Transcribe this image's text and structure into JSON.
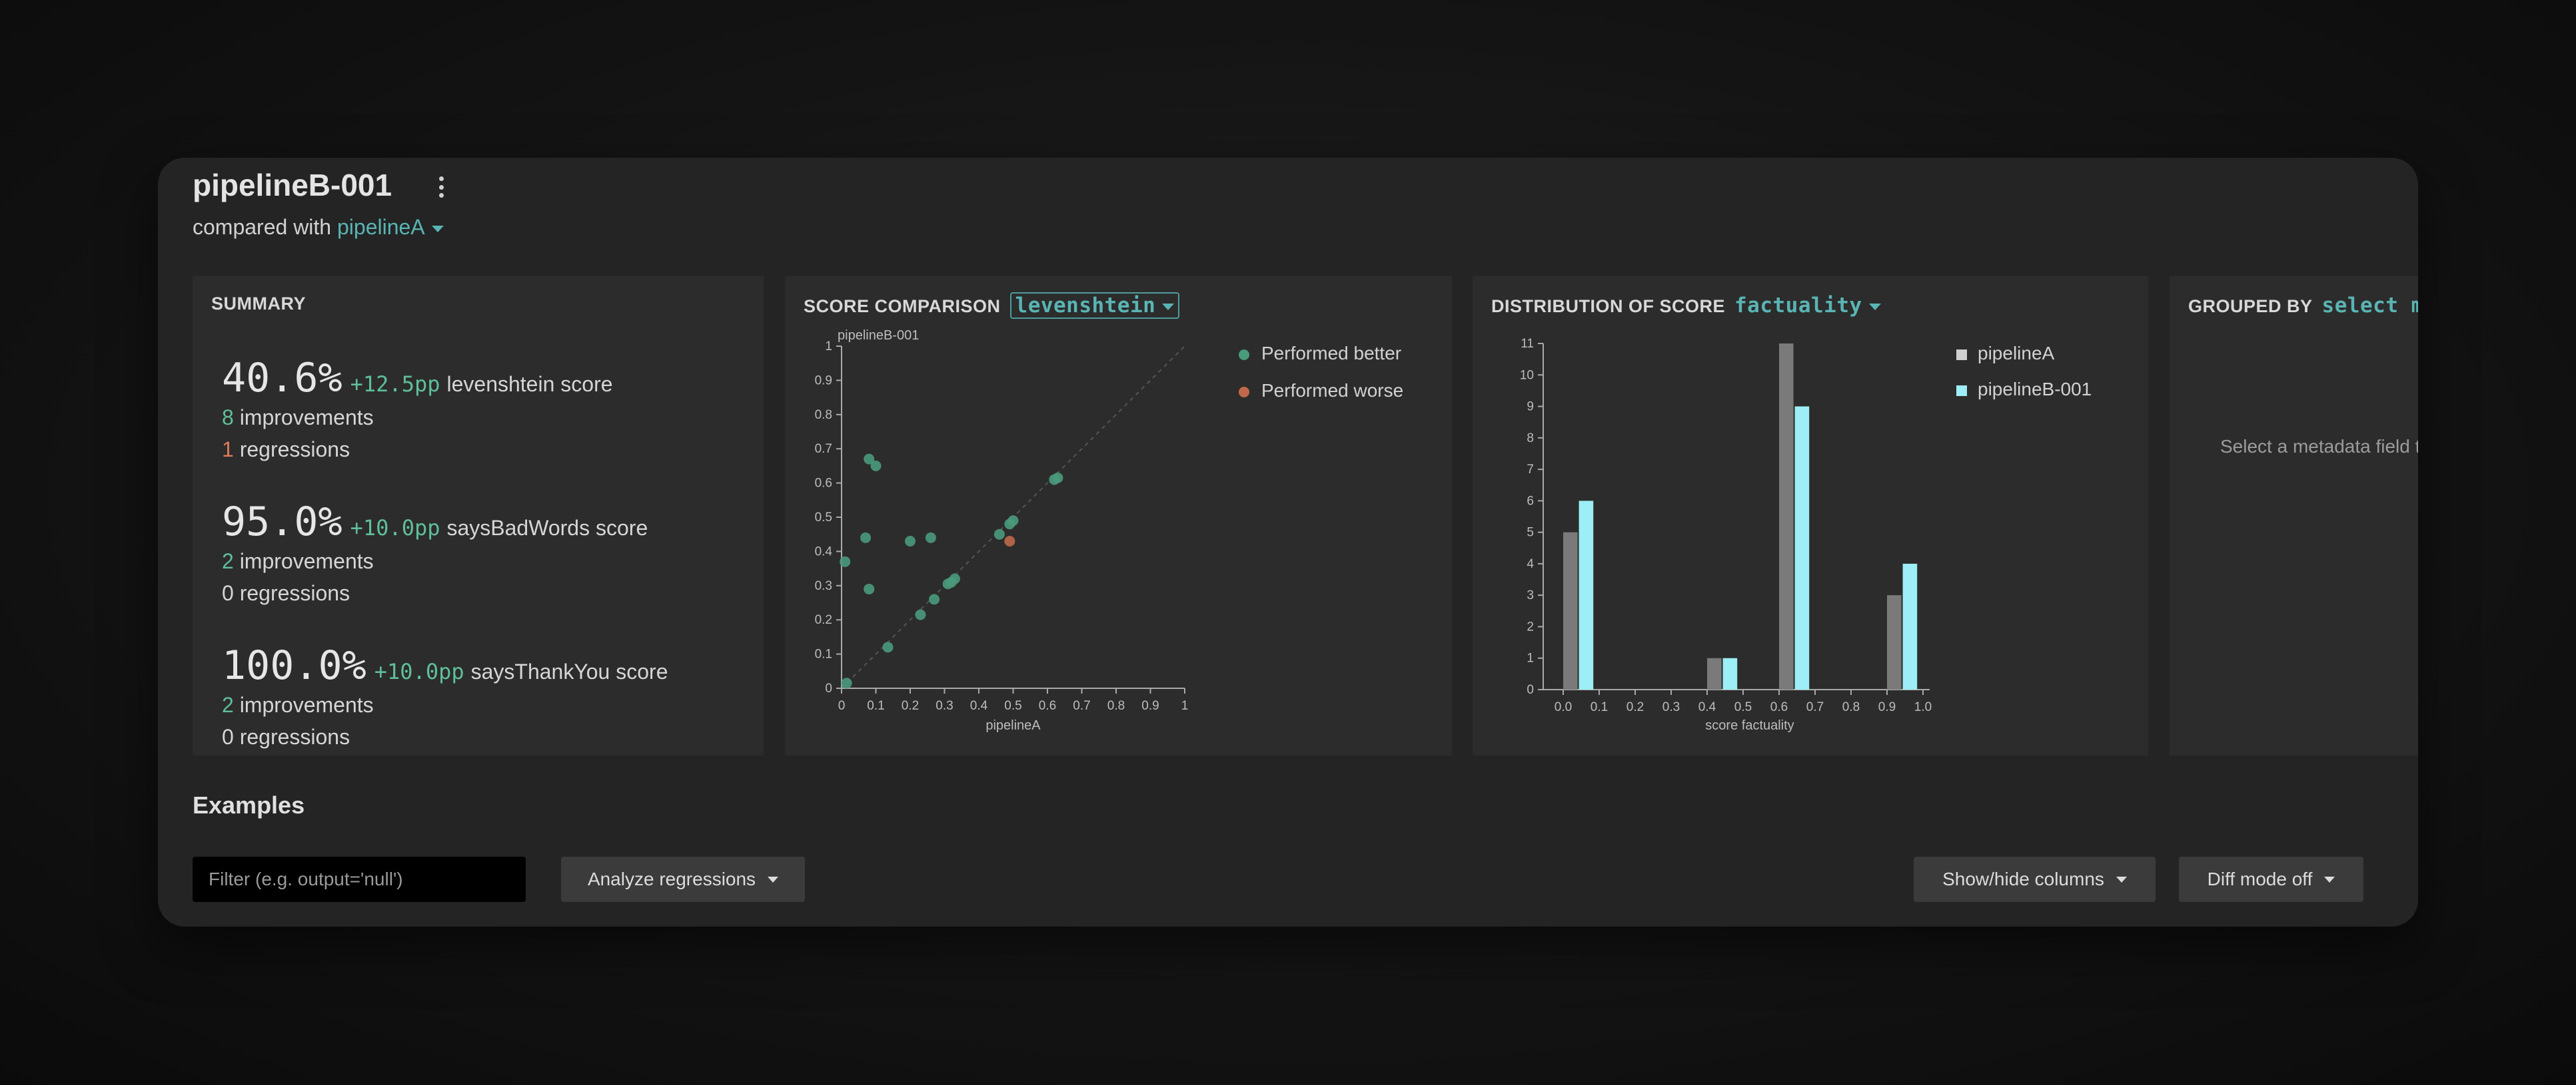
{
  "header": {
    "title": "pipelineB-001",
    "compared_prefix": "compared with",
    "compared_selection": "pipelineA"
  },
  "summary": {
    "title": "SUMMARY",
    "metrics": [
      {
        "value": "40.6%",
        "delta": "+12.5pp",
        "name": "levenshtein score",
        "improvements_count": "8",
        "improvements_label": "improvements",
        "regressions_count": "1",
        "regressions_label": "regressions"
      },
      {
        "value": "95.0%",
        "delta": "+10.0pp",
        "name": "saysBadWords score",
        "improvements_count": "2",
        "improvements_label": "improvements",
        "regressions_count": "0",
        "regressions_label": "regressions"
      },
      {
        "value": "100.0%",
        "delta": "+10.0pp",
        "name": "saysThankYou score",
        "improvements_count": "2",
        "improvements_label": "improvements",
        "regressions_count": "0",
        "regressions_label": "regressions"
      }
    ]
  },
  "score_comparison": {
    "title": "SCORE COMPARISON",
    "selection": "levenshtein",
    "legend": {
      "better": "Performed better",
      "worse": "Performed worse"
    },
    "colors": {
      "better": "#4a9a7c",
      "worse": "#c0694a"
    }
  },
  "distribution": {
    "title": "DISTRIBUTION OF SCORE",
    "selection": "factuality",
    "legend": [
      "pipelineA",
      "pipelineB-001"
    ],
    "colors": {
      "pipelineA": "#7a7a7a",
      "pipelineB-001": "#9deef6"
    }
  },
  "grouped": {
    "title": "GROUPED BY",
    "selection": "select m",
    "message": "Select a metadata field t"
  },
  "examples": {
    "title": "Examples",
    "filter_placeholder": "Filter (e.g. output='null')",
    "analyze_button": "Analyze regressions",
    "columns_button": "Show/hide columns",
    "diff_button": "Diff mode off"
  },
  "chart_data": [
    {
      "type": "scatter",
      "xlabel": "pipelineA",
      "ylabel": "pipelineB-001",
      "xlim": [
        0,
        1
      ],
      "ylim": [
        0,
        1
      ],
      "x_ticks": [
        "0",
        "0.1",
        "0.2",
        "0.3",
        "0.4",
        "0.5",
        "0.6",
        "0.7",
        "0.8",
        "0.9",
        "1"
      ],
      "y_ticks": [
        "0",
        "0.1",
        "0.2",
        "0.3",
        "0.4",
        "0.5",
        "0.6",
        "0.7",
        "0.8",
        "0.9",
        "1"
      ],
      "series": [
        {
          "name": "Performed better",
          "points": [
            [
              0.015,
              0.015
            ],
            [
              0.01,
              0.37
            ],
            [
              0.08,
              0.67
            ],
            [
              0.1,
              0.65
            ],
            [
              0.07,
              0.44
            ],
            [
              0.08,
              0.29
            ],
            [
              0.2,
              0.43
            ],
            [
              0.26,
              0.44
            ],
            [
              0.135,
              0.12
            ],
            [
              0.23,
              0.215
            ],
            [
              0.27,
              0.26
            ],
            [
              0.31,
              0.305
            ],
            [
              0.32,
              0.31
            ],
            [
              0.33,
              0.32
            ],
            [
              0.46,
              0.45
            ],
            [
              0.49,
              0.48
            ],
            [
              0.5,
              0.49
            ],
            [
              0.62,
              0.61
            ],
            [
              0.63,
              0.615
            ]
          ]
        },
        {
          "name": "Performed worse",
          "points": [
            [
              0.49,
              0.43
            ]
          ]
        }
      ]
    },
    {
      "type": "bar",
      "xlabel": "score factuality",
      "x_ticks": [
        "0.0",
        "0.1",
        "0.2",
        "0.3",
        "0.4",
        "0.5",
        "0.6",
        "0.7",
        "0.8",
        "0.9",
        "1.0"
      ],
      "y_ticks": [
        "0",
        "1",
        "2",
        "3",
        "4",
        "5",
        "6",
        "7",
        "8",
        "9",
        "10",
        "11"
      ],
      "ylim": [
        0,
        11
      ],
      "bin_width": 0.1,
      "series": [
        {
          "name": "pipelineA",
          "bins": [
            0.0,
            0.4,
            0.6,
            0.9
          ],
          "values": [
            5,
            1,
            11,
            3
          ]
        },
        {
          "name": "pipelineB-001",
          "bins": [
            0.0,
            0.4,
            0.6,
            0.9
          ],
          "values": [
            6,
            1,
            9,
            4
          ]
        }
      ]
    }
  ]
}
